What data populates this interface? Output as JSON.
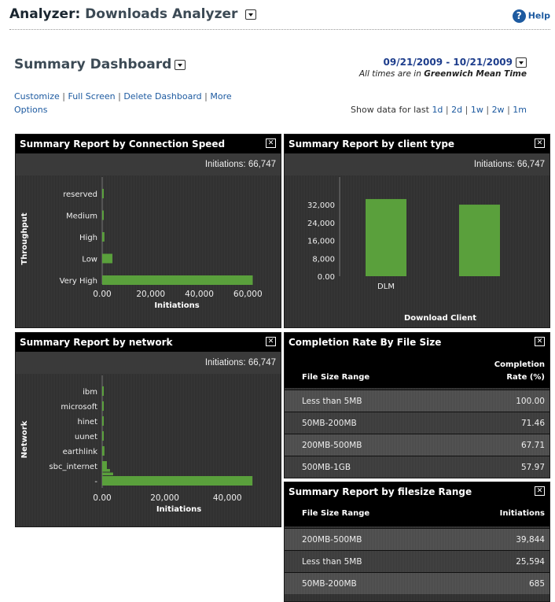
{
  "header": {
    "label": "Analyzer:",
    "analyzer_name": "Downloads Analyzer",
    "help": "Help"
  },
  "dashboard": {
    "title": "Summary Dashboard",
    "date_range": "09/21/2009 - 10/21/2009",
    "tz_prefix": "All times are in",
    "tz_name": "Greenwich Mean Time",
    "links": {
      "customize": "Customize",
      "full_screen": "Full Screen",
      "delete": "Delete Dashboard",
      "more": "More",
      "options": "Options"
    },
    "show_data": {
      "label": "Show data for last",
      "options": [
        "1d",
        "2d",
        "1w",
        "2w",
        "1m"
      ]
    }
  },
  "panels": {
    "connection_speed": {
      "title": "Summary Report by Connection Speed",
      "initiations": "Initiations: 66,747"
    },
    "client_type": {
      "title": "Summary Report by client type",
      "initiations": "Initiations: 66,747"
    },
    "network": {
      "title": "Summary Report by network",
      "initiations": "Initiations: 66,747"
    },
    "completion_rate": {
      "title": "Completion Rate By File Size",
      "col1": "File Size Range",
      "col2_line1": "Completion",
      "col2_line2": "Rate (%)",
      "rows": [
        {
          "range": "Less than 5MB",
          "value": "100.00"
        },
        {
          "range": "50MB-200MB",
          "value": "71.46"
        },
        {
          "range": "200MB-500MB",
          "value": "67.71"
        },
        {
          "range": "500MB-1GB",
          "value": "57.97"
        }
      ]
    },
    "filesize_range": {
      "title": "Summary Report by filesize Range",
      "col1": "File Size Range",
      "col2": "Initiations",
      "rows": [
        {
          "range": "200MB-500MB",
          "value": "39,844"
        },
        {
          "range": "Less than 5MB",
          "value": "25,594"
        },
        {
          "range": "50MB-200MB",
          "value": "685"
        }
      ]
    }
  },
  "chart_data": [
    {
      "type": "bar",
      "orientation": "horizontal",
      "categories": [
        "reserved",
        "Medium",
        "High",
        "Low",
        "Very High"
      ],
      "values": [
        300,
        600,
        900,
        4200,
        62000
      ],
      "xlabel": "Initiations",
      "ylabel": "Throughput",
      "xticks": [
        "0.00",
        "20,000",
        "40,000",
        "60,000"
      ],
      "xlim": [
        0,
        68000
      ],
      "color": "#5aa03c"
    },
    {
      "type": "bar",
      "orientation": "vertical",
      "categories": [
        "DLM",
        ""
      ],
      "values": [
        34500,
        32000
      ],
      "xlabel": "Download Client",
      "ylabel": "",
      "yticks": [
        "0.00",
        "8,000",
        "16,000",
        "24,000",
        "32,000"
      ],
      "ylim": [
        0,
        38000
      ],
      "color": "#5aa03c"
    },
    {
      "type": "bar",
      "orientation": "horizontal",
      "categories": [
        "ibm",
        "microsoft",
        "hinet",
        "uunet",
        "earthlink",
        "sbc_internet",
        "-"
      ],
      "values": [
        200,
        300,
        400,
        500,
        700,
        1500,
        48000
      ],
      "extra_small_bars": [
        2500,
        3500,
        4500,
        5500
      ],
      "xlabel": "Initiations",
      "ylabel": "Network",
      "xticks": [
        "0.00",
        "20,000",
        "40,000"
      ],
      "xlim": [
        0,
        54000
      ],
      "color": "#5aa03c"
    }
  ]
}
